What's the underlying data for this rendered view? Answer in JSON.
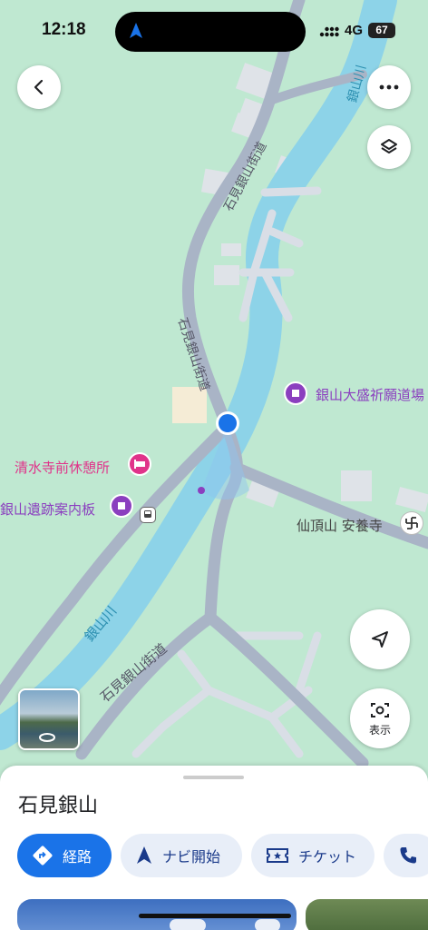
{
  "status_bar": {
    "time": "12:18",
    "network": "4G",
    "battery": "67"
  },
  "map": {
    "road_labels": [
      "石見銀山街道",
      "石見銀山街道",
      "石見銀山街道"
    ],
    "river_labels": [
      "銀山川",
      "銀山川"
    ],
    "pois": [
      {
        "name": "銀山大盛祈願道場",
        "color": "#8b3fbf",
        "icon": "place-of-worship-icon"
      },
      {
        "name": "清水寺前休憩所",
        "color": "#e0338a",
        "icon": "lodging-icon"
      },
      {
        "name": "銀山遺跡案内板",
        "color": "#8b3fbf",
        "icon": "landmark-icon"
      },
      {
        "name": "仙頂山 安養寺",
        "color": "#555555",
        "icon": "temple-icon"
      }
    ]
  },
  "controls": {
    "view_button_label": "表示"
  },
  "place": {
    "title": "石見銀山",
    "actions": [
      {
        "label": "経路",
        "icon": "directions-icon"
      },
      {
        "label": "ナビ開始",
        "icon": "navigation-icon"
      },
      {
        "label": "チケット",
        "icon": "ticket-icon"
      },
      {
        "label": "",
        "icon": "phone-icon"
      }
    ]
  },
  "colors": {
    "accent": "#1a73e8",
    "map_bg": "#bfe8d1",
    "river": "#8dd3e8",
    "road": "#a9b4c6",
    "user_dot": "#1a73e8"
  }
}
